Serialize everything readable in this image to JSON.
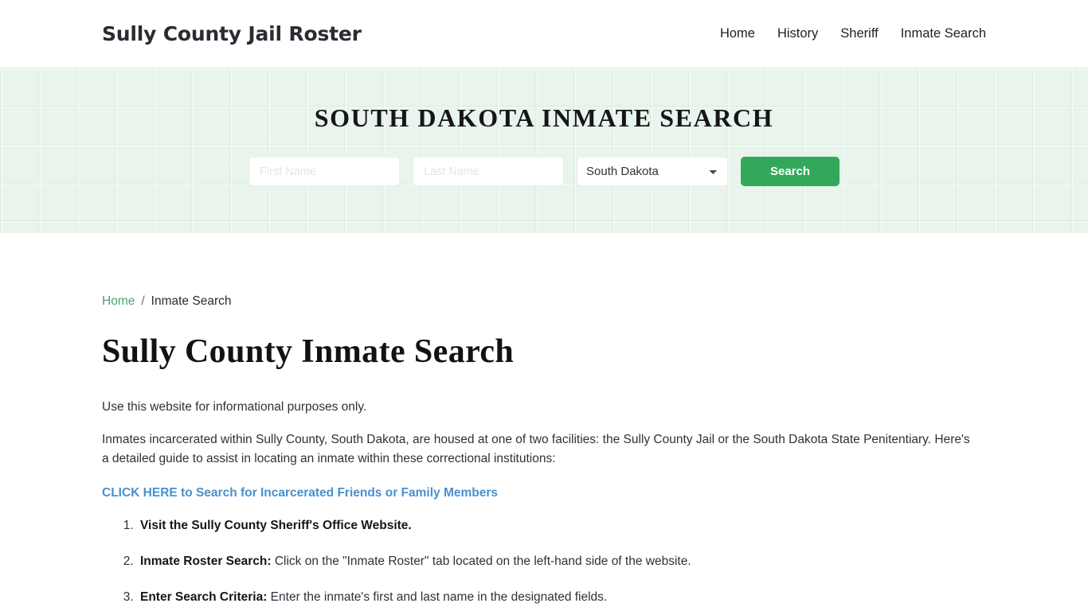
{
  "header": {
    "brand": "Sully County Jail Roster",
    "nav": [
      {
        "label": "Home"
      },
      {
        "label": "History"
      },
      {
        "label": "Sheriff"
      },
      {
        "label": "Inmate Search"
      }
    ]
  },
  "hero": {
    "title": "SOUTH DAKOTA INMATE SEARCH",
    "background_color": "#e8f4ec",
    "form": {
      "first_name_placeholder": "First Name",
      "first_name_value": "",
      "last_name_placeholder": "Last Name",
      "last_name_value": "",
      "state_selected": "South Dakota",
      "state_options": [
        "South Dakota"
      ],
      "search_label": "Search",
      "search_color": "#34a85a",
      "chevron_icon": "chevron-down-icon"
    }
  },
  "breadcrumb": {
    "home_label": "Home",
    "separator": "/",
    "current_label": "Inmate Search",
    "link_color": "#4f9e72"
  },
  "main": {
    "page_title": "Sully County Inmate Search",
    "paragraph_1": "Use this website for informational purposes only.",
    "paragraph_2": "Inmates incarcerated within Sully County, South Dakota, are housed at one of two facilities: the Sully County Jail or the South Dakota State Penitentiary. Here's a detailed guide to assist in locating an inmate within these correctional institutions:",
    "cta_label": "CLICK HERE to Search for Incarcerated Friends or Family Members",
    "cta_color": "#4a90cc",
    "steps": [
      {
        "label": "Visit the Sully County Sheriff's Office Website.",
        "text": ""
      },
      {
        "label": "Inmate Roster Search:",
        "text": " Click on the \"Inmate Roster\" tab located on the left-hand side of the website."
      },
      {
        "label": "Enter Search Criteria:",
        "text": " Enter the inmate's first and last name in the designated fields."
      }
    ]
  }
}
